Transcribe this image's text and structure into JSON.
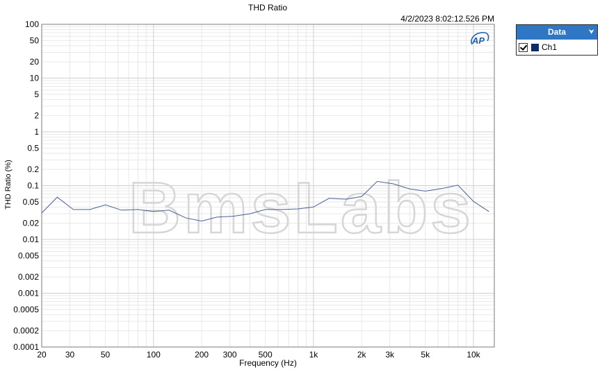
{
  "chart_data": {
    "type": "line",
    "title": "THD Ratio",
    "timestamp": "4/2/2023 8:02:12.526 PM",
    "xlabel": "Frequency (Hz)",
    "ylabel": "THD Ratio (%)",
    "x_scale": "log",
    "y_scale": "log",
    "xlim": [
      20,
      13500
    ],
    "ylim": [
      0.0001,
      100
    ],
    "grid": true,
    "x_ticks": [
      {
        "v": 20,
        "label": "20"
      },
      {
        "v": 30,
        "label": "30"
      },
      {
        "v": 50,
        "label": "50"
      },
      {
        "v": 100,
        "label": "100"
      },
      {
        "v": 200,
        "label": "200"
      },
      {
        "v": 300,
        "label": "300"
      },
      {
        "v": 500,
        "label": "500"
      },
      {
        "v": 1000,
        "label": "1k"
      },
      {
        "v": 2000,
        "label": "2k"
      },
      {
        "v": 3000,
        "label": "3k"
      },
      {
        "v": 5000,
        "label": "5k"
      },
      {
        "v": 10000,
        "label": "10k"
      }
    ],
    "y_ticks": [
      {
        "v": 100,
        "label": "100"
      },
      {
        "v": 50,
        "label": "50"
      },
      {
        "v": 20,
        "label": "20"
      },
      {
        "v": 10,
        "label": "10"
      },
      {
        "v": 5,
        "label": "5"
      },
      {
        "v": 2,
        "label": "2"
      },
      {
        "v": 1,
        "label": "1"
      },
      {
        "v": 0.5,
        "label": "0.5"
      },
      {
        "v": 0.2,
        "label": "0.2"
      },
      {
        "v": 0.1,
        "label": "0.1"
      },
      {
        "v": 0.05,
        "label": "0.05"
      },
      {
        "v": 0.02,
        "label": "0.02"
      },
      {
        "v": 0.01,
        "label": "0.01"
      },
      {
        "v": 0.005,
        "label": "0.005"
      },
      {
        "v": 0.002,
        "label": "0.002"
      },
      {
        "v": 0.001,
        "label": "0.001"
      },
      {
        "v": 0.0005,
        "label": "0.0005"
      },
      {
        "v": 0.0002,
        "label": "0.0002"
      },
      {
        "v": 0.0001,
        "label": "0.0001"
      }
    ],
    "series": [
      {
        "name": "Ch1",
        "color": "#4a5f94",
        "x": [
          20,
          25,
          31.5,
          40,
          50,
          63,
          80,
          100,
          125,
          160,
          200,
          250,
          315,
          400,
          500,
          630,
          800,
          1000,
          1250,
          1600,
          2000,
          2500,
          3150,
          4000,
          5000,
          6300,
          8000,
          10000,
          12500
        ],
        "y": [
          0.031,
          0.061,
          0.036,
          0.036,
          0.044,
          0.035,
          0.036,
          0.033,
          0.035,
          0.025,
          0.022,
          0.026,
          0.027,
          0.03,
          0.036,
          0.036,
          0.037,
          0.04,
          0.058,
          0.056,
          0.063,
          0.12,
          0.108,
          0.087,
          0.079,
          0.088,
          0.102,
          0.051,
          0.033
        ]
      }
    ]
  },
  "legend": {
    "header": "Data",
    "pin_icon": "pin-icon",
    "swatch_color": "#0f2a6b"
  },
  "logo": {
    "text": "AP",
    "color": "#1f5fb0"
  },
  "watermark": {
    "text": "BmsLabs"
  }
}
